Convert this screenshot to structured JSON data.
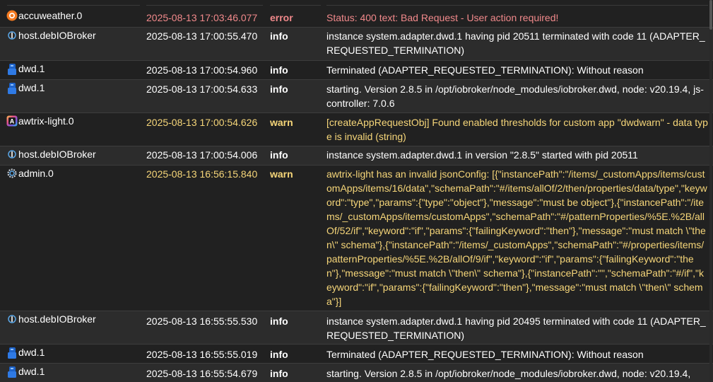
{
  "colors": {
    "error": "#f1898b",
    "warn": "#f6d679",
    "info": "#ffffff",
    "background": "#212121",
    "alt_row": "#2c2c2c"
  },
  "rows": [
    {
      "source": "accuweather.0",
      "icon": "accuweather-icon",
      "time": "2025-08-13 17:03:46.077",
      "severity": "error",
      "message": "Status: 400 text: Bad Request - User action required!"
    },
    {
      "source": "host.debIOBroker",
      "icon": "host-icon",
      "time": "2025-08-13 17:00:55.470",
      "severity": "info",
      "message": "instance system.adapter.dwd.1 having pid 20511 terminated with code 11 (ADAPTER_REQUESTED_TERMINATION)"
    },
    {
      "source": "dwd.1",
      "icon": "dwd-icon",
      "time": "2025-08-13 17:00:54.960",
      "severity": "info",
      "message": "Terminated (ADAPTER_REQUESTED_TERMINATION): Without reason"
    },
    {
      "source": "dwd.1",
      "icon": "dwd-icon",
      "time": "2025-08-13 17:00:54.633",
      "severity": "info",
      "message": "starting. Version 2.8.5 in /opt/iobroker/node_modules/iobroker.dwd, node: v20.19.4, js-controller: 7.0.6"
    },
    {
      "source": "awtrix-light.0",
      "icon": "awtrix-icon",
      "time": "2025-08-13 17:00:54.626",
      "severity": "warn",
      "message": "[createAppRequestObj] Found enabled thresholds for custom app \"dwdwarn\" - data type is invalid (string)"
    },
    {
      "source": "host.debIOBroker",
      "icon": "host-icon",
      "time": "2025-08-13 17:00:54.006",
      "severity": "info",
      "message": "instance system.adapter.dwd.1 in version \"2.8.5\" started with pid 20511"
    },
    {
      "source": "admin.0",
      "icon": "admin-gear-icon",
      "time": "2025-08-13 16:56:15.840",
      "severity": "warn",
      "message": "awtrix-light has an invalid jsonConfig: [{\"instancePath\":\"/items/_customApps/items/customApps/items/16/data\",\"schemaPath\":\"#/items/allOf/2/then/properties/data/type\",\"keyword\":\"type\",\"params\":{\"type\":\"object\"},\"message\":\"must be object\"},{\"instancePath\":\"/items/_customApps/items/customApps\",\"schemaPath\":\"#/patternProperties/%5E.%2B/allOf/52/if\",\"keyword\":\"if\",\"params\":{\"failingKeyword\":\"then\"},\"message\":\"must match \\\"then\\\" schema\"},{\"instancePath\":\"/items/_customApps\",\"schemaPath\":\"#/properties/items/patternProperties/%5E.%2B/allOf/9/if\",\"keyword\":\"if\",\"params\":{\"failingKeyword\":\"then\"},\"message\":\"must match \\\"then\\\" schema\"},{\"instancePath\":\"\",\"schemaPath\":\"#/if\",\"keyword\":\"if\",\"params\":{\"failingKeyword\":\"then\"},\"message\":\"must match \\\"then\\\" schema\"}]"
    },
    {
      "source": "host.debIOBroker",
      "icon": "host-icon",
      "time": "2025-08-13 16:55:55.530",
      "severity": "info",
      "message": "instance system.adapter.dwd.1 having pid 20495 terminated with code 11 (ADAPTER_REQUESTED_TERMINATION)"
    },
    {
      "source": "dwd.1",
      "icon": "dwd-icon",
      "time": "2025-08-13 16:55:55.019",
      "severity": "info",
      "message": "Terminated (ADAPTER_REQUESTED_TERMINATION): Without reason"
    },
    {
      "source": "dwd.1",
      "icon": "dwd-icon",
      "time": "2025-08-13 16:55:54.679",
      "severity": "info",
      "message": "starting. Version 2.8.5 in /opt/iobroker/node_modules/iobroker.dwd, node: v20.19.4,"
    }
  ]
}
